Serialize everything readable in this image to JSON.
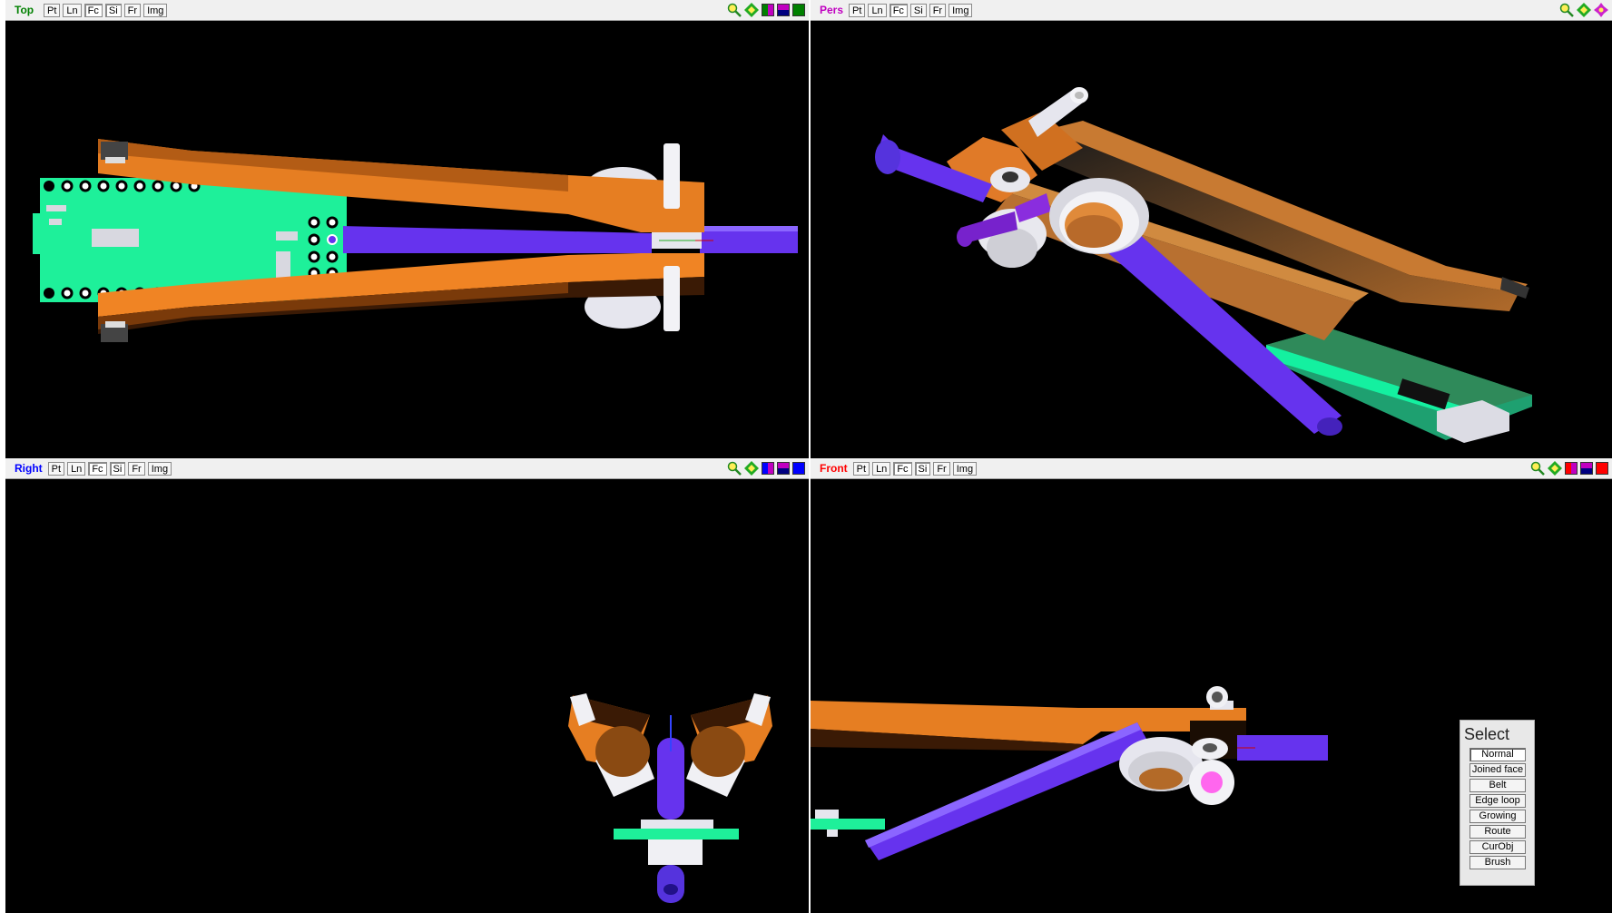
{
  "views": {
    "top": {
      "title": "Top",
      "title_color": "#008000"
    },
    "pers": {
      "title": "Pers",
      "title_color": "#c000c0"
    },
    "right": {
      "title": "Right",
      "title_color": "#0000ff"
    },
    "front": {
      "title": "Front",
      "title_color": "#ff0000"
    }
  },
  "toolbar": {
    "pt": "Pt",
    "ln": "Ln",
    "fc": "Fc",
    "si": "Si",
    "fr": "Fr",
    "img": "Img"
  },
  "swatches": {
    "top": [
      "#008000",
      "#c000c0",
      "#008000"
    ],
    "right": [
      "#0000ff",
      "#c000c0",
      "#0000ff"
    ],
    "front": [
      "#ff0000",
      "#c000c0",
      "#ff0000"
    ]
  },
  "icons": [
    "zoom-icon",
    "fit-view-icon",
    "rotate-icon"
  ],
  "select_panel": {
    "title": "Select",
    "options": [
      "Normal",
      "Joined face",
      "Belt",
      "Edge loop",
      "Growing",
      "Route",
      "CurObj",
      "Brush"
    ]
  },
  "colors": {
    "orange": "#e67e22",
    "purple": "#6633ee",
    "pcb": "#1ef09a",
    "white": "#e8e8ee"
  }
}
